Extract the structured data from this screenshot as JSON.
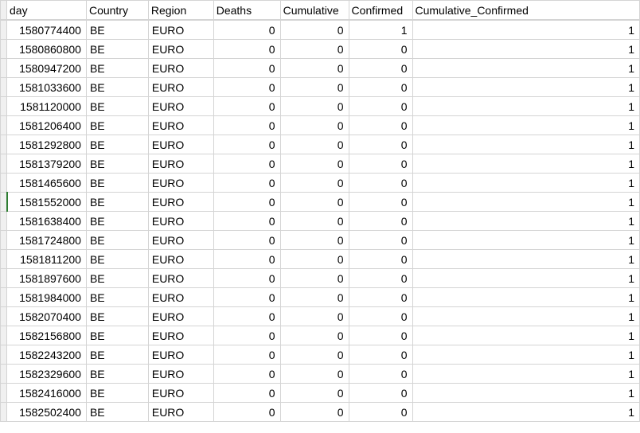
{
  "headers": {
    "day": "day",
    "country": "Country",
    "region": "Region",
    "deaths": "Deaths",
    "cumdeaths": "Cumulative",
    "confirmed": "Confirmed",
    "cumconf": "Cumulative_Confirmed"
  },
  "rows": [
    {
      "day": "1580774400",
      "country": "BE",
      "region": "EURO",
      "deaths": "0",
      "cumdeaths": "0",
      "confirmed": "1",
      "cumconf": "1",
      "highlight": false
    },
    {
      "day": "1580860800",
      "country": "BE",
      "region": "EURO",
      "deaths": "0",
      "cumdeaths": "0",
      "confirmed": "0",
      "cumconf": "1",
      "highlight": false
    },
    {
      "day": "1580947200",
      "country": "BE",
      "region": "EURO",
      "deaths": "0",
      "cumdeaths": "0",
      "confirmed": "0",
      "cumconf": "1",
      "highlight": false
    },
    {
      "day": "1581033600",
      "country": "BE",
      "region": "EURO",
      "deaths": "0",
      "cumdeaths": "0",
      "confirmed": "0",
      "cumconf": "1",
      "highlight": false
    },
    {
      "day": "1581120000",
      "country": "BE",
      "region": "EURO",
      "deaths": "0",
      "cumdeaths": "0",
      "confirmed": "0",
      "cumconf": "1",
      "highlight": false
    },
    {
      "day": "1581206400",
      "country": "BE",
      "region": "EURO",
      "deaths": "0",
      "cumdeaths": "0",
      "confirmed": "0",
      "cumconf": "1",
      "highlight": false
    },
    {
      "day": "1581292800",
      "country": "BE",
      "region": "EURO",
      "deaths": "0",
      "cumdeaths": "0",
      "confirmed": "0",
      "cumconf": "1",
      "highlight": false
    },
    {
      "day": "1581379200",
      "country": "BE",
      "region": "EURO",
      "deaths": "0",
      "cumdeaths": "0",
      "confirmed": "0",
      "cumconf": "1",
      "highlight": false
    },
    {
      "day": "1581465600",
      "country": "BE",
      "region": "EURO",
      "deaths": "0",
      "cumdeaths": "0",
      "confirmed": "0",
      "cumconf": "1",
      "highlight": false
    },
    {
      "day": "1581552000",
      "country": "BE",
      "region": "EURO",
      "deaths": "0",
      "cumdeaths": "0",
      "confirmed": "0",
      "cumconf": "1",
      "highlight": true
    },
    {
      "day": "1581638400",
      "country": "BE",
      "region": "EURO",
      "deaths": "0",
      "cumdeaths": "0",
      "confirmed": "0",
      "cumconf": "1",
      "highlight": false
    },
    {
      "day": "1581724800",
      "country": "BE",
      "region": "EURO",
      "deaths": "0",
      "cumdeaths": "0",
      "confirmed": "0",
      "cumconf": "1",
      "highlight": false
    },
    {
      "day": "1581811200",
      "country": "BE",
      "region": "EURO",
      "deaths": "0",
      "cumdeaths": "0",
      "confirmed": "0",
      "cumconf": "1",
      "highlight": false
    },
    {
      "day": "1581897600",
      "country": "BE",
      "region": "EURO",
      "deaths": "0",
      "cumdeaths": "0",
      "confirmed": "0",
      "cumconf": "1",
      "highlight": false
    },
    {
      "day": "1581984000",
      "country": "BE",
      "region": "EURO",
      "deaths": "0",
      "cumdeaths": "0",
      "confirmed": "0",
      "cumconf": "1",
      "highlight": false
    },
    {
      "day": "1582070400",
      "country": "BE",
      "region": "EURO",
      "deaths": "0",
      "cumdeaths": "0",
      "confirmed": "0",
      "cumconf": "1",
      "highlight": false
    },
    {
      "day": "1582156800",
      "country": "BE",
      "region": "EURO",
      "deaths": "0",
      "cumdeaths": "0",
      "confirmed": "0",
      "cumconf": "1",
      "highlight": false
    },
    {
      "day": "1582243200",
      "country": "BE",
      "region": "EURO",
      "deaths": "0",
      "cumdeaths": "0",
      "confirmed": "0",
      "cumconf": "1",
      "highlight": false
    },
    {
      "day": "1582329600",
      "country": "BE",
      "region": "EURO",
      "deaths": "0",
      "cumdeaths": "0",
      "confirmed": "0",
      "cumconf": "1",
      "highlight": false
    },
    {
      "day": "1582416000",
      "country": "BE",
      "region": "EURO",
      "deaths": "0",
      "cumdeaths": "0",
      "confirmed": "0",
      "cumconf": "1",
      "highlight": false
    },
    {
      "day": "1582502400",
      "country": "BE",
      "region": "EURO",
      "deaths": "0",
      "cumdeaths": "0",
      "confirmed": "0",
      "cumconf": "1",
      "highlight": false
    }
  ]
}
